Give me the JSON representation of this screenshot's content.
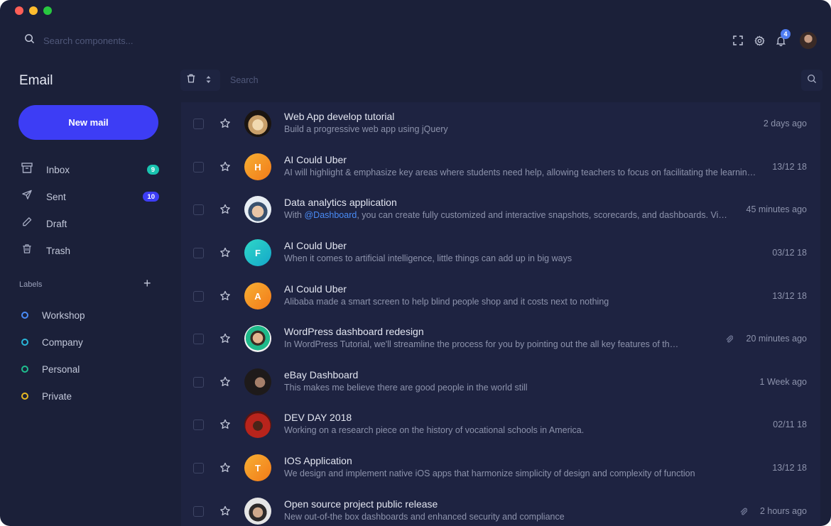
{
  "window": {
    "traffic_colors": [
      "#ff5f57",
      "#febc2e",
      "#28c840"
    ]
  },
  "topbar": {
    "search_placeholder": "Search components...",
    "icons": [
      "search-icon",
      "fullscreen-icon",
      "gear-icon",
      "bell-icon",
      "avatar"
    ],
    "notification_count": "4"
  },
  "sidebar": {
    "title": "Email",
    "new_mail_label": "New mail",
    "nav": [
      {
        "label": "Inbox",
        "icon": "archive-icon",
        "badge": "9",
        "badge_color": "#19c3b0"
      },
      {
        "label": "Sent",
        "icon": "send-icon",
        "badge": "10",
        "badge_color": "#3d3df5"
      },
      {
        "label": "Draft",
        "icon": "pencil-icon",
        "badge": "",
        "badge_color": ""
      },
      {
        "label": "Trash",
        "icon": "trash-icon",
        "badge": "",
        "badge_color": ""
      }
    ],
    "labels_heading": "Labels",
    "labels_add": "+",
    "labels": [
      {
        "label": "Workshop",
        "color": "#4a8cf7"
      },
      {
        "label": "Company",
        "color": "#29b6d9"
      },
      {
        "label": "Personal",
        "color": "#1fbf8f"
      },
      {
        "label": "Private",
        "color": "#e8b923"
      }
    ]
  },
  "mail_toolbar": {
    "search_placeholder": "Search"
  },
  "mails": [
    {
      "title": "Web App develop tutorial",
      "snippet": "Build a progressive web app using jQuery",
      "time": "2 days ago",
      "avatar": "photo",
      "initial": "",
      "attachment": false
    },
    {
      "title": "AI Could Uber",
      "snippet": "AI will highlight & emphasize key areas where students need help, allowing teachers to focus on facilitating the learning process.",
      "time": "13/12 18",
      "avatar": "initial",
      "initial": "H",
      "attachment": false
    },
    {
      "title": "Data analytics application",
      "snippet_pre": "With ",
      "mention": "@Dashboard",
      "snippet": ", you can create fully customized and interactive snapshots, scorecards, and dashboards. Visit our site for more.",
      "time": "45 minutes ago",
      "avatar": "photo",
      "initial": "",
      "attachment": false
    },
    {
      "title": "AI Could Uber",
      "snippet": "When it comes to artificial intelligence, little things can add up in big ways",
      "time": "03/12 18",
      "avatar": "initial",
      "initial": "F",
      "attachment": false
    },
    {
      "title": "AI Could Uber",
      "snippet": "Alibaba made a smart screen to help blind people shop and it costs next to nothing",
      "time": "13/12 18",
      "avatar": "initial",
      "initial": "A",
      "attachment": false
    },
    {
      "title": "WordPress dashboard redesign",
      "snippet": "In WordPress Tutorial, we'll streamline the process for you by pointing out the all key features of the dashboard.",
      "time": "20 minutes ago",
      "avatar": "photo",
      "initial": "",
      "attachment": true
    },
    {
      "title": "eBay Dashboard",
      "snippet": "This makes me believe there are good people in the world still",
      "time": "1 Week ago",
      "avatar": "photo",
      "initial": "",
      "attachment": false
    },
    {
      "title": "DEV DAY 2018",
      "snippet": "Working on a research piece on the history of vocational schools in America.",
      "time": "02/11 18",
      "avatar": "photo",
      "initial": "",
      "attachment": false
    },
    {
      "title": "IOS Application",
      "snippet": "We design and implement native iOS apps that harmonize simplicity of design and complexity of function",
      "time": "13/12 18",
      "avatar": "initial",
      "initial": "T",
      "attachment": false
    },
    {
      "title": "Open source project public release",
      "snippet": "New out-of-the box dashboards and enhanced security and compliance",
      "time": "2 hours ago",
      "avatar": "photo",
      "initial": "",
      "attachment": true
    }
  ]
}
